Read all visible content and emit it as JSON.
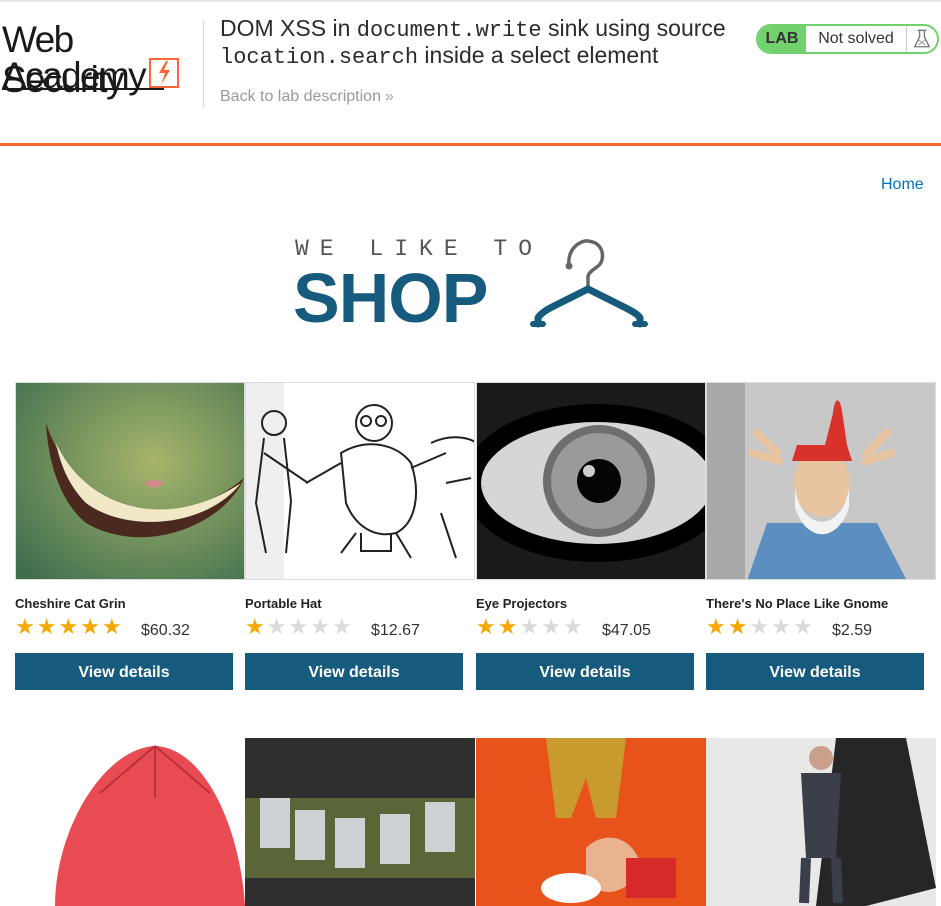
{
  "header": {
    "logo_line1": "Web Security",
    "logo_line2": "Academy",
    "title_parts": [
      "DOM XSS in ",
      "document.write",
      " sink using source ",
      "location.search",
      " inside a select element"
    ],
    "back_link": "Back to lab description",
    "badge_label": "LAB",
    "badge_status": "Not solved",
    "accent": "#ff6633",
    "badge_color": "#70d16d"
  },
  "nav": {
    "home": "Home"
  },
  "brand": {
    "small": "WE LIKE TO",
    "big": "SHOP",
    "color": "#165a7d"
  },
  "products": [
    {
      "name": "Cheshire Cat Grin",
      "rating": 5,
      "price": "$60.32",
      "button": "View details",
      "image_icon": "cheshire-cat-image"
    },
    {
      "name": "Portable Hat",
      "rating": 1,
      "price": "$12.67",
      "button": "View details",
      "image_icon": "portable-hat-sketch-image"
    },
    {
      "name": "Eye Projectors",
      "rating": 2,
      "price": "$47.05",
      "button": "View details",
      "image_icon": "eye-closeup-image"
    },
    {
      "name": "There's No Place Like Gnome",
      "rating": 2,
      "price": "$2.59",
      "button": "View details",
      "image_icon": "gnome-man-image"
    }
  ],
  "row2_images": [
    "red-umbrella-image",
    "beer-can-belt-image",
    "toy-figures-image",
    "businessman-phone-image"
  ]
}
